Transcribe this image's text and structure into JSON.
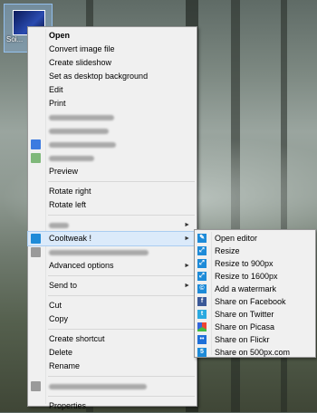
{
  "desktop": {
    "icon_label": "Soi..."
  },
  "menu": {
    "open": "Open",
    "convert": "Convert image file",
    "slideshow": "Create slideshow",
    "set_bg": "Set as desktop background",
    "edit": "Edit",
    "print": "Print",
    "preview": "Preview",
    "rotate_right": "Rotate right",
    "rotate_left": "Rotate left",
    "cooltweak": "Cooltweak !",
    "advanced": "Advanced options",
    "send_to": "Send to",
    "cut": "Cut",
    "copy": "Copy",
    "create_shortcut": "Create shortcut",
    "delete": "Delete",
    "rename": "Rename",
    "properties": "Properties",
    "arrow": "►"
  },
  "submenu": {
    "items": [
      {
        "label": "Open editor",
        "icon": "cooltweak-icon",
        "color": "#1e8bd8"
      },
      {
        "label": "Resize",
        "icon": "resize-icon",
        "color": "#1e8bd8"
      },
      {
        "label": "Resize to 900px",
        "icon": "resize-icon",
        "color": "#1e8bd8"
      },
      {
        "label": "Resize to 1600px",
        "icon": "resize-icon",
        "color": "#1e8bd8"
      },
      {
        "label": "Add a watermark",
        "icon": "watermark-icon",
        "color": "#1e8bd8"
      },
      {
        "label": "Share on Facebook",
        "icon": "facebook-icon",
        "color": "#3b5998"
      },
      {
        "label": "Share on Twitter",
        "icon": "twitter-icon",
        "color": "#2aa9e0"
      },
      {
        "label": "Share on Picasa",
        "icon": "picasa-icon",
        "color": "#d04a9a"
      },
      {
        "label": "Share on Flickr",
        "icon": "flickr-icon",
        "color": "#1e6fd8"
      },
      {
        "label": "Share on 500px.com",
        "icon": "500px-icon",
        "color": "#1e8bd8"
      }
    ]
  }
}
